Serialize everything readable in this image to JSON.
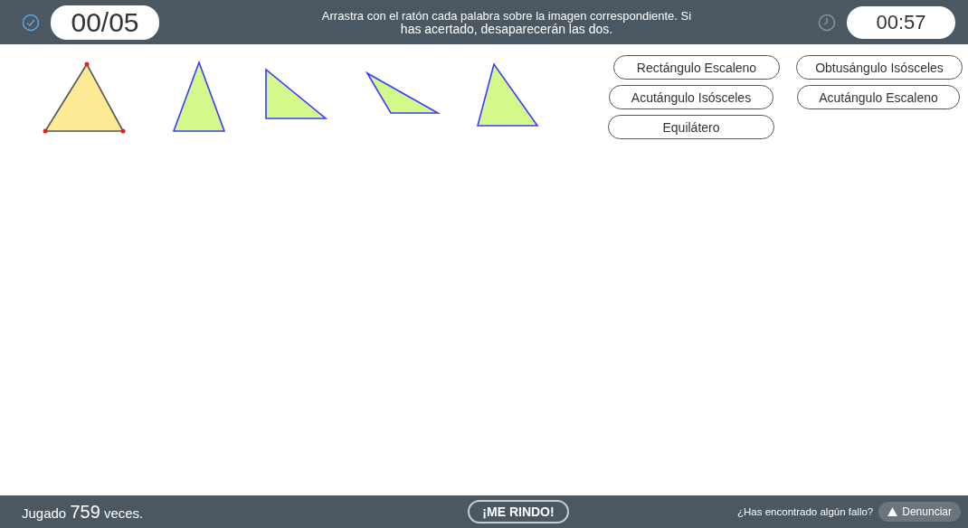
{
  "header": {
    "score": "00/05",
    "instructions": [
      "Arrastra con el ratón cada palabra sobre la imagen correspondiente. Si",
      "has acertado, desaparecerán las dos."
    ],
    "timer": "00:57"
  },
  "words": [
    {
      "label": "Rectángulo Escaleno"
    },
    {
      "label": "Obtusángulo Isósceles"
    },
    {
      "label": "Acutángulo Isósceles"
    },
    {
      "label": "Acutángulo Escaleno"
    },
    {
      "label": "Equilátero"
    }
  ],
  "footer": {
    "played_prefix": "Jugado",
    "played_count": "759",
    "played_suffix": "veces.",
    "give_up": "¡ME RINDO!",
    "report_question": "¿Has encontrado algún fallo?",
    "report_button": "Denunciar"
  }
}
